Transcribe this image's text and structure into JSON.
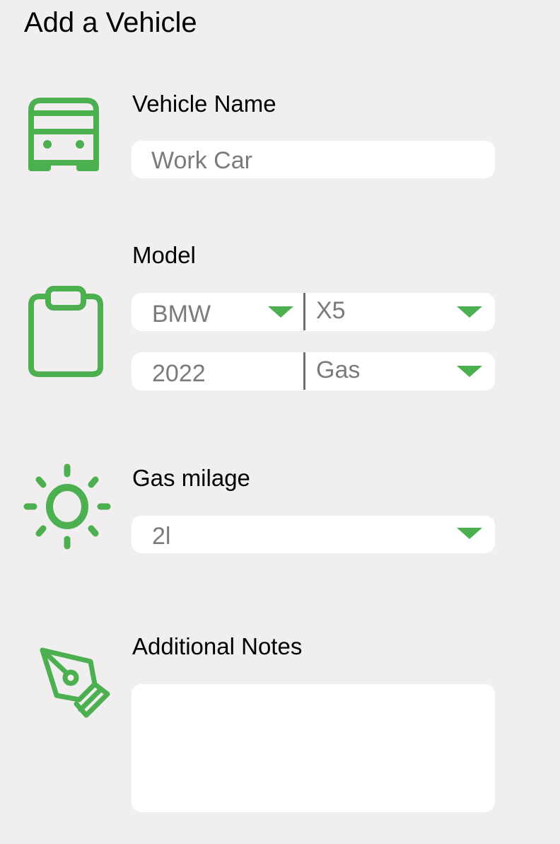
{
  "page": {
    "title": "Add a Vehicle"
  },
  "accent_color": "#4caf50",
  "sections": {
    "vehicle_name": {
      "icon": "bus-icon",
      "label": "Vehicle Name",
      "input_value": "Work Car"
    },
    "model": {
      "icon": "clipboard-icon",
      "label": "Model",
      "make": "BMW",
      "model": "X5",
      "year": "2022",
      "fuel": "Gas"
    },
    "gas_mileage": {
      "icon": "sun-icon",
      "label": "Gas milage",
      "value": "2l"
    },
    "notes": {
      "icon": "pen-icon",
      "label": "Additional Notes",
      "value": ""
    }
  }
}
